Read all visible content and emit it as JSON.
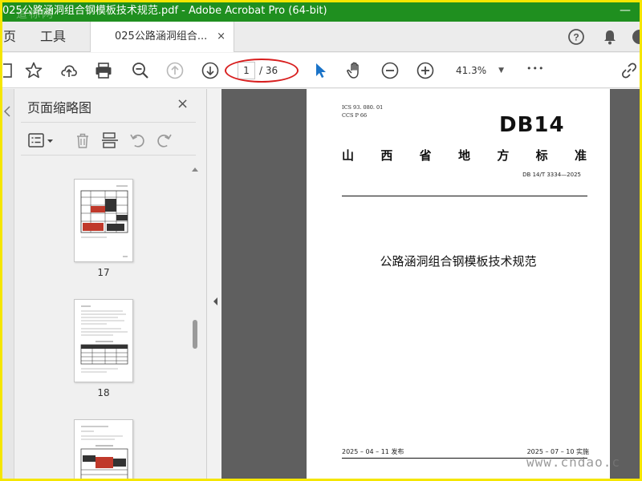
{
  "window": {
    "title": "025公路涵洞组合钢模板技术规范.pdf - Adobe Acrobat Pro (64-bit)",
    "minimize_glyph": "—",
    "watermark": "道标网"
  },
  "tabs": {
    "home": "页",
    "tools": "工具",
    "doc_tab": "025公路涵洞组合...",
    "close": "×"
  },
  "toolbar": {
    "current_page": "1",
    "total_pages": "/ 36",
    "zoom": "41.3%",
    "zoom_caret": "▼",
    "more": "•••"
  },
  "thumbnail_panel": {
    "title": "页面缩略图",
    "close": "×",
    "thumbnails": [
      {
        "label": "17"
      },
      {
        "label": "18"
      },
      {
        "label": ""
      }
    ]
  },
  "document": {
    "ics": "ICS  93. 080. 01",
    "ccs": "CCS  P  66",
    "logo": "DB14",
    "province_chars": [
      "山",
      "西",
      "省",
      "地",
      "方",
      "标",
      "准"
    ],
    "standard_number": "DB 14/T  3334—2025",
    "title": "公路涵洞组合钢模板技术规范",
    "issue_date": "2025 – 04 – 11 发布",
    "implement_date": "2025 – 07 – 10 实施"
  },
  "watermark_bottom": "www.cndao.c",
  "colors": {
    "titlebar": "#1f8f1f",
    "highlight_ellipse": "#d81e1e",
    "frame": "#f5e600",
    "select_tool": "#1a73c8"
  }
}
